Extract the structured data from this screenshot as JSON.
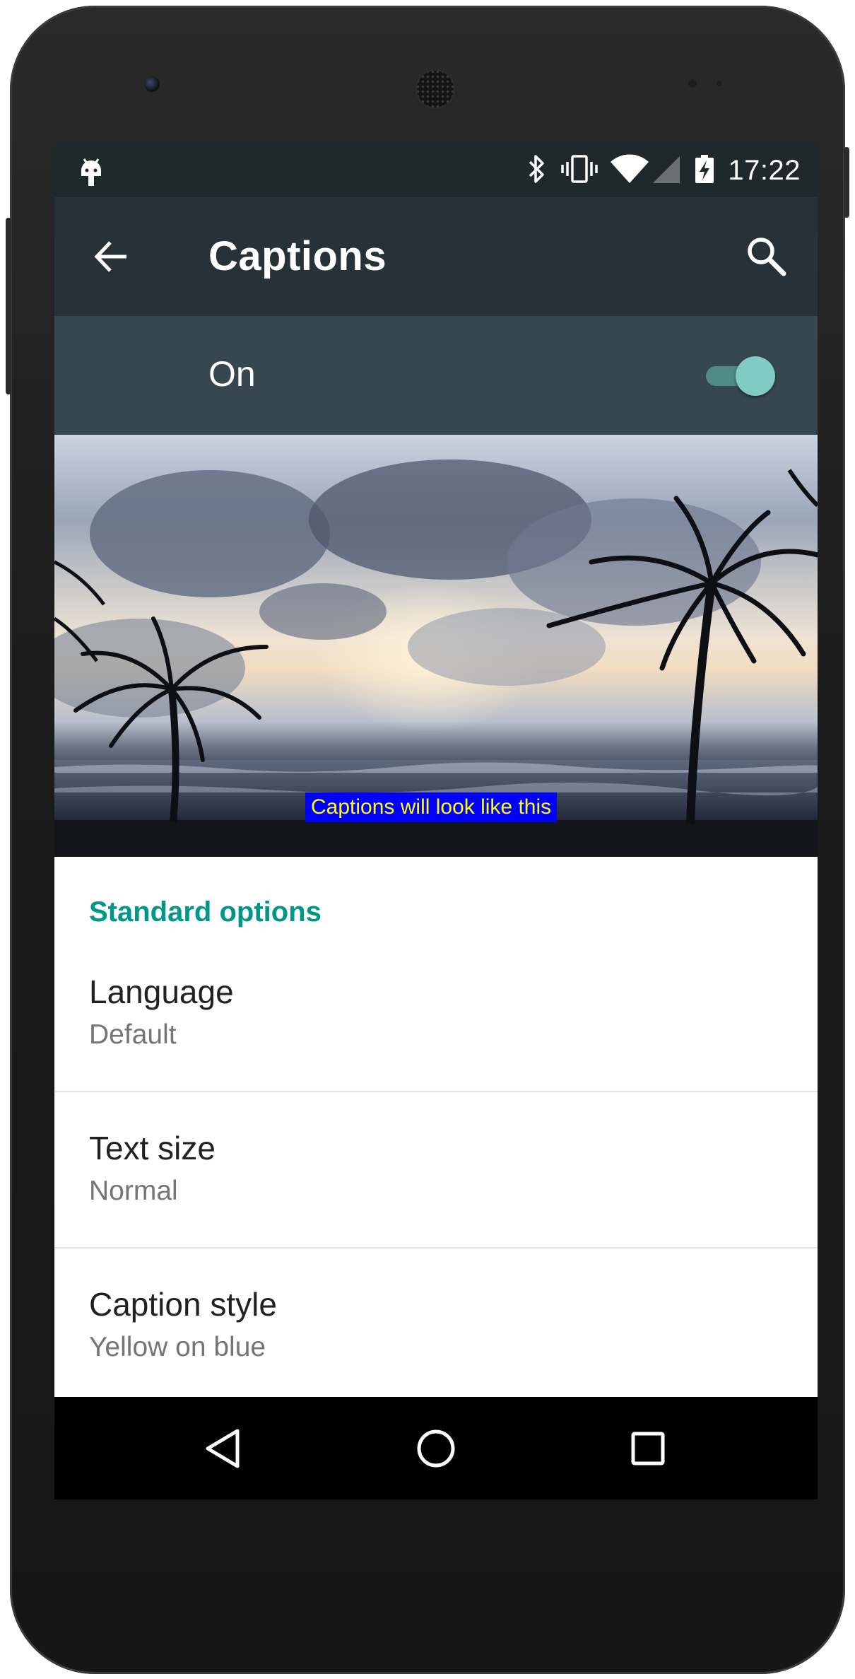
{
  "status_bar": {
    "time": "17:22",
    "icons": [
      "android-debug-icon",
      "bluetooth-icon",
      "vibrate-icon",
      "wifi-icon",
      "cell-signal-icon",
      "battery-charging-icon"
    ]
  },
  "app_bar": {
    "title": "Captions",
    "back_icon": "arrow-back-icon",
    "search_icon": "search-icon"
  },
  "master_switch": {
    "label": "On",
    "checked": true,
    "accent_color": "#80cbc4"
  },
  "preview": {
    "caption_text": "Captions will look like this",
    "caption_text_color": "#ffff00",
    "caption_background_color": "#0000ff"
  },
  "standard_options": {
    "header": "Standard options",
    "header_color": "#009688",
    "items": [
      {
        "title": "Language",
        "summary": "Default"
      },
      {
        "title": "Text size",
        "summary": "Normal"
      },
      {
        "title": "Caption style",
        "summary": "Yellow on blue"
      }
    ]
  },
  "navigation_bar": {
    "buttons": [
      "back-triangle-icon",
      "home-circle-icon",
      "recents-square-icon"
    ]
  },
  "colors": {
    "status_bar": "#1f282d",
    "app_bar": "#263238",
    "switch_bar": "#37474f"
  }
}
